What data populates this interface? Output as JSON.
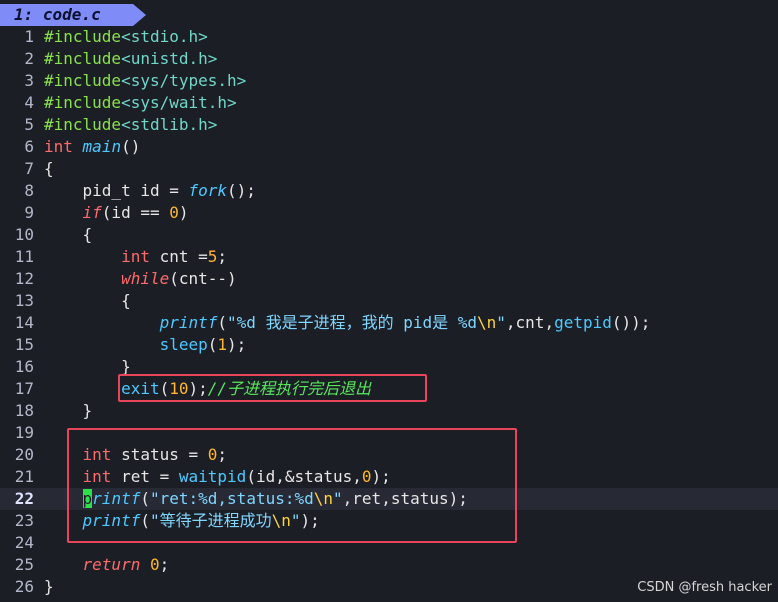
{
  "tab": {
    "label": "1: code.c"
  },
  "current_line": 22,
  "watermark": "CSDN @fresh hacker",
  "colors": {
    "background": "#1c1e26",
    "tab_bg": "#7f8cf7",
    "preprocessor": "#89e24a",
    "keyword": "#ff6b6b",
    "function": "#4dc9ff",
    "number": "#ffb62e",
    "comment": "#56e85a",
    "highlight_box": "#e8455a",
    "cursor": "#2de14a"
  },
  "lines": [
    {
      "n": "1",
      "segs": [
        [
          "pp",
          "#include"
        ],
        [
          "hd",
          "<stdio.h>"
        ]
      ]
    },
    {
      "n": "2",
      "segs": [
        [
          "pp",
          "#include"
        ],
        [
          "hd",
          "<unistd.h>"
        ]
      ]
    },
    {
      "n": "3",
      "segs": [
        [
          "pp",
          "#include"
        ],
        [
          "hd",
          "<sys/types.h>"
        ]
      ]
    },
    {
      "n": "4",
      "segs": [
        [
          "pp",
          "#include"
        ],
        [
          "hd",
          "<sys/wait.h>"
        ]
      ]
    },
    {
      "n": "5",
      "segs": [
        [
          "pp",
          "#include"
        ],
        [
          "hd",
          "<stdlib.h>"
        ]
      ]
    },
    {
      "n": "6",
      "segs": [
        [
          "ty",
          "int"
        ],
        [
          "br",
          " "
        ],
        [
          "fn-i",
          "main"
        ],
        [
          "br",
          "()"
        ]
      ]
    },
    {
      "n": "7",
      "segs": [
        [
          "br",
          "{"
        ]
      ]
    },
    {
      "n": "8",
      "segs": [
        [
          "br",
          "    pid_t id = "
        ],
        [
          "fn-i",
          "fork"
        ],
        [
          "br",
          "();"
        ]
      ]
    },
    {
      "n": "9",
      "segs": [
        [
          "br",
          "    "
        ],
        [
          "kw",
          "if"
        ],
        [
          "br",
          "(id == "
        ],
        [
          "num-l",
          "0"
        ],
        [
          "br",
          ")"
        ]
      ]
    },
    {
      "n": "10",
      "segs": [
        [
          "br",
          "    {"
        ]
      ]
    },
    {
      "n": "11",
      "segs": [
        [
          "br",
          "        "
        ],
        [
          "ty",
          "int"
        ],
        [
          "br",
          " cnt ="
        ],
        [
          "num-l",
          "5"
        ],
        [
          "br",
          ";"
        ]
      ]
    },
    {
      "n": "12",
      "segs": [
        [
          "br",
          "        "
        ],
        [
          "kw",
          "while"
        ],
        [
          "br",
          "(cnt--)"
        ]
      ]
    },
    {
      "n": "13",
      "segs": [
        [
          "br",
          "        {"
        ]
      ]
    },
    {
      "n": "14",
      "segs": [
        [
          "br",
          "            "
        ],
        [
          "fn-i",
          "printf"
        ],
        [
          "br",
          "("
        ],
        [
          "str",
          "\"%d 我是子进程，我的 pid是 %d"
        ],
        [
          "esc",
          "\\n"
        ],
        [
          "str",
          "\""
        ],
        [
          "br",
          ",cnt,"
        ],
        [
          "fn",
          "getpid"
        ],
        [
          "br",
          "());"
        ]
      ]
    },
    {
      "n": "15",
      "segs": [
        [
          "br",
          "            "
        ],
        [
          "fn",
          "sleep"
        ],
        [
          "br",
          "("
        ],
        [
          "num-l",
          "1"
        ],
        [
          "br",
          ");"
        ]
      ]
    },
    {
      "n": "16",
      "segs": [
        [
          "br",
          "        }"
        ]
      ]
    },
    {
      "n": "17",
      "segs": [
        [
          "br",
          "        "
        ],
        [
          "fn",
          "exit"
        ],
        [
          "br",
          "("
        ],
        [
          "num-l",
          "10"
        ],
        [
          "br",
          ");"
        ],
        [
          "cm",
          "//子进程执行完后退出"
        ]
      ]
    },
    {
      "n": "18",
      "segs": [
        [
          "br",
          "    }"
        ]
      ]
    },
    {
      "n": "19",
      "segs": []
    },
    {
      "n": "20",
      "segs": [
        [
          "br",
          "    "
        ],
        [
          "ty",
          "int"
        ],
        [
          "br",
          " status = "
        ],
        [
          "num-l",
          "0"
        ],
        [
          "br",
          ";"
        ]
      ]
    },
    {
      "n": "21",
      "segs": [
        [
          "br",
          "    "
        ],
        [
          "ty",
          "int"
        ],
        [
          "br",
          " ret = "
        ],
        [
          "fn",
          "waitpid"
        ],
        [
          "br",
          "(id,&status,"
        ],
        [
          "num-l",
          "0"
        ],
        [
          "br",
          ");"
        ]
      ]
    },
    {
      "n": "22",
      "segs": [
        [
          "br",
          "    "
        ],
        [
          "cursor",
          "p"
        ],
        [
          "fn-i",
          "rintf"
        ],
        [
          "br",
          "("
        ],
        [
          "str",
          "\"ret:%d,status:%d"
        ],
        [
          "esc",
          "\\n"
        ],
        [
          "str",
          "\""
        ],
        [
          "br",
          ",ret,status);"
        ]
      ]
    },
    {
      "n": "23",
      "segs": [
        [
          "br",
          "    "
        ],
        [
          "fn-i",
          "printf"
        ],
        [
          "br",
          "("
        ],
        [
          "str",
          "\"等待子进程成功"
        ],
        [
          "esc",
          "\\n"
        ],
        [
          "str",
          "\""
        ],
        [
          "br",
          ");"
        ]
      ]
    },
    {
      "n": "24",
      "segs": []
    },
    {
      "n": "25",
      "segs": [
        [
          "br",
          "    "
        ],
        [
          "kw",
          "return"
        ],
        [
          "br",
          " "
        ],
        [
          "num-l",
          "0"
        ],
        [
          "br",
          ";"
        ]
      ]
    },
    {
      "n": "26",
      "segs": [
        [
          "br",
          "}"
        ]
      ]
    }
  ]
}
